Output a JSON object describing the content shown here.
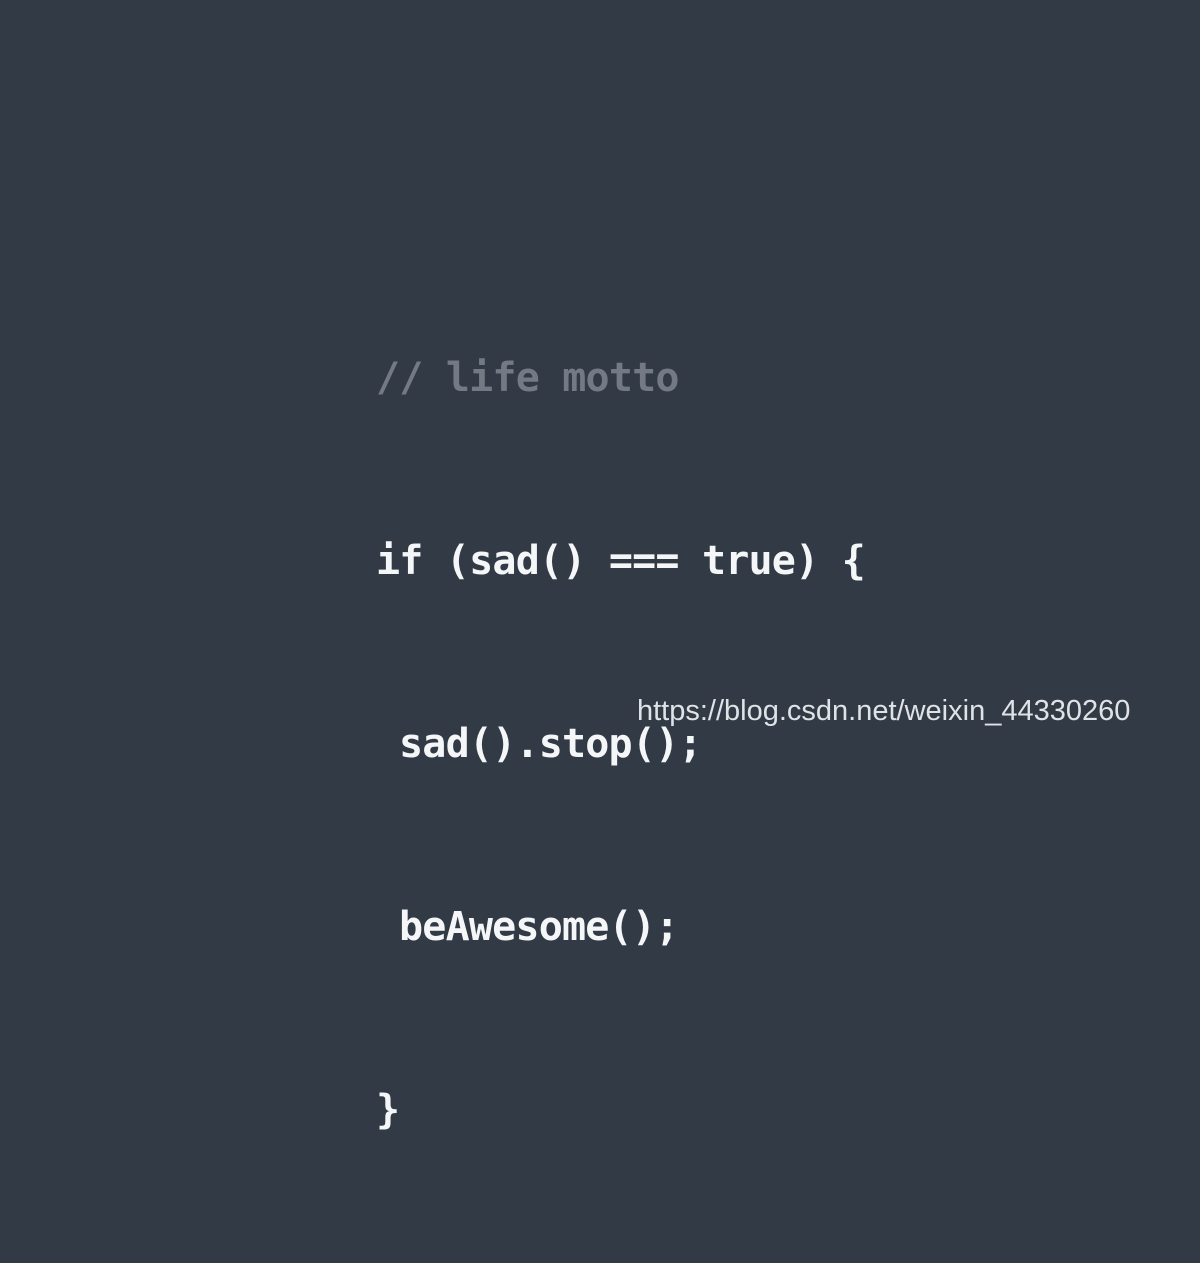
{
  "background_color": "#323a45",
  "code_color": "#f4f6f8",
  "comment_color": "#737a84",
  "code": {
    "comment": "// life motto",
    "line_1": "if (sad() === true) {",
    "line_2": "sad().stop();",
    "line_3": "beAwesome();",
    "line_4": "}"
  },
  "watermark": {
    "text": "https://blog.csdn.net/weixin_44330260"
  }
}
